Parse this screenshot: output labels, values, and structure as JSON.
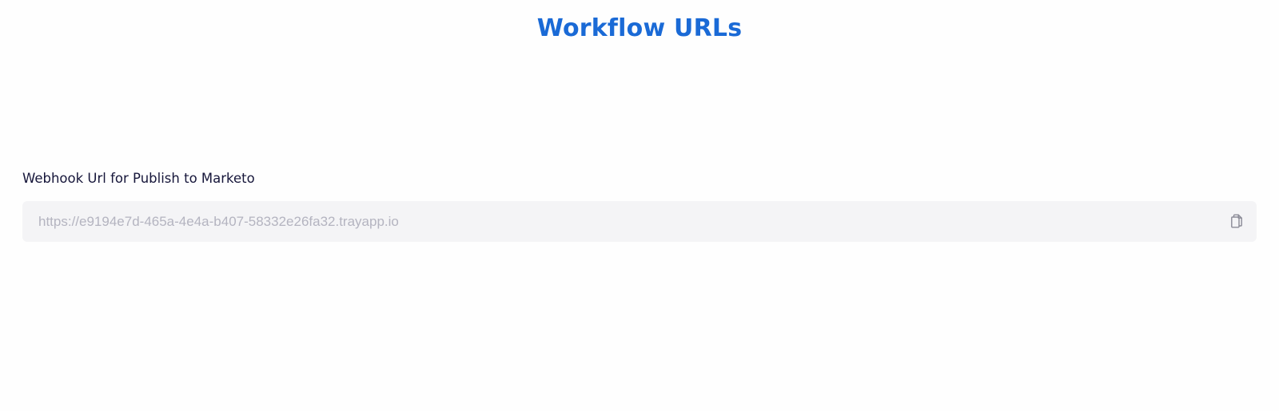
{
  "header": {
    "title": "Workflow URLs"
  },
  "webhook": {
    "label": "Webhook Url for Publish to Marketo",
    "url": "https://e9194e7d-465a-4e4a-b407-58332e26fa32.trayapp.io",
    "copy_icon": "copy-icon"
  },
  "colors": {
    "title": "#1a6ad6",
    "label": "#16163a",
    "field_background": "#f4f4f6",
    "field_text": "#b4b4c0",
    "icon": "#8a8a96"
  }
}
